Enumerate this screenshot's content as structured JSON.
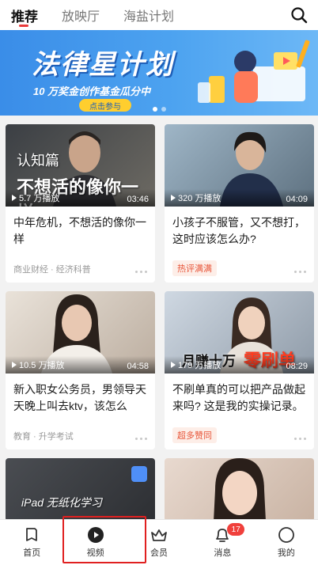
{
  "tabs": [
    {
      "label": "推荐",
      "active": true
    },
    {
      "label": "放映厅",
      "active": false
    },
    {
      "label": "海盐计划",
      "active": false
    }
  ],
  "banner": {
    "title": "法律星计划",
    "subtitle": "10 万奖金创作基金瓜分中",
    "cta": "点击参与"
  },
  "cards": [
    {
      "thumb_text1": "认知篇",
      "thumb_text2": "不想活的像你一样",
      "views": "5.7 万播放",
      "duration": "03:46",
      "title": "中年危机，不想活的像你一样",
      "meta": "商业财经 · 经济科普",
      "tag": ""
    },
    {
      "views": "320 万播放",
      "duration": "04:09",
      "title": "小孩子不服管，又不想打，这时应该怎么办?",
      "meta": "",
      "tag": "热评满满"
    },
    {
      "views": "10.5 万播放",
      "duration": "04:58",
      "title": "新入职女公务员，男领导天天晚上叫去ktv，该怎么",
      "meta": "教育 · 升学考试",
      "tag": ""
    },
    {
      "thumb_text1": "月赚十万",
      "thumb_text2": "零刷单",
      "views": "179 万播放",
      "duration": "08:29",
      "title": "不刷单真的可以把产品做起来吗? 这是我的实操记录。",
      "meta": "",
      "tag": "超多赞同"
    },
    {
      "thumb_text1": "iPad 无纸化学习"
    },
    {}
  ],
  "bottom_nav": [
    {
      "label": "首页",
      "icon": "home-icon"
    },
    {
      "label": "视频",
      "icon": "video-play-icon"
    },
    {
      "label": "会员",
      "icon": "vip-crown-icon"
    },
    {
      "label": "消息",
      "icon": "bell-icon",
      "badge": "17"
    },
    {
      "label": "我的",
      "icon": "profile-icon"
    }
  ],
  "colors": {
    "accent": "#e93b3b",
    "banner": "#3a8de8",
    "highlight": "#e02020"
  }
}
